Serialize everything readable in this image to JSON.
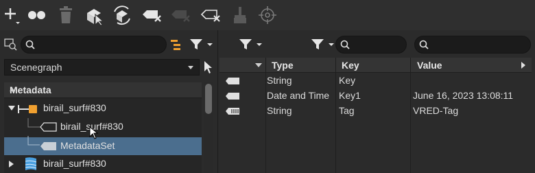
{
  "toolbar": {
    "icons": [
      "add-icon",
      "link-nodes-icon",
      "delete-icon",
      "select-with-metadata-icon",
      "refresh-metadata-icon",
      "tag-remove-icon",
      "tag-disabled-icon",
      "tag-edit-icon",
      "clean-icon",
      "target-icon"
    ]
  },
  "left": {
    "search_placeholder": "",
    "scenegraph_label": "Scenegraph",
    "tree_header": "Metadata",
    "tree": [
      {
        "label": "birail_surf#830",
        "type": "node"
      },
      {
        "label": "birail_surf#830",
        "type": "metadata-object"
      },
      {
        "label": "MetadataSet",
        "type": "metadata-set",
        "selected": true
      },
      {
        "label": "birail_surf#830",
        "type": "surface"
      }
    ]
  },
  "right": {
    "search1_placeholder": "",
    "search2_placeholder": "",
    "columns": {
      "type": "Type",
      "key": "Key",
      "value": "Value"
    },
    "rows": [
      {
        "type": "String",
        "key": "Key",
        "value": ""
      },
      {
        "type": "Date and Time",
        "key": "Key1",
        "value": "June 16, 2023 13:08:11"
      },
      {
        "type": "String",
        "key": "Tag",
        "value": "VRED-Tag"
      }
    ]
  },
  "colors": {
    "accent_orange": "#f0a030",
    "selection": "#4b6e8e",
    "icon_blue": "#4aa0e0"
  }
}
